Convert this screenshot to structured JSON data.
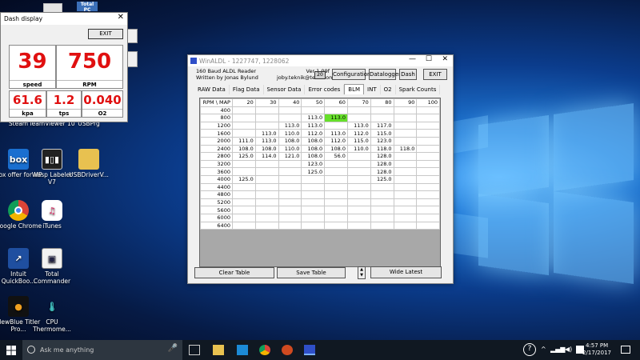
{
  "desktop_icons": [
    {
      "label": "Steam"
    },
    {
      "label": "TeamViewer 10"
    },
    {
      "label": "USBPrg"
    },
    {
      "label": "Box offer for HP",
      "badge": "box"
    },
    {
      "label": "Wasp Labeler V7"
    },
    {
      "label": "USBDriverV..."
    },
    {
      "label": "Google Chrome"
    },
    {
      "label": "iTunes"
    },
    {
      "label": "Intuit QuickBoo..."
    },
    {
      "label": "Total Commander"
    },
    {
      "label": "NewBlue Titler Pro..."
    },
    {
      "label": "CPU Thermome..."
    }
  ],
  "dash": {
    "title": "Dash display",
    "exit": "EXIT",
    "gauges": [
      {
        "value": "39",
        "label": "speed"
      },
      {
        "value": "750",
        "label": "RPM"
      },
      {
        "value": "61.6",
        "label": "kpa"
      },
      {
        "value": "1.2",
        "label": "tps"
      },
      {
        "value": "0.040",
        "label": "O2"
      }
    ]
  },
  "winaldl": {
    "title": "WinALDL - 1227747, 1228062",
    "line1": "160 Baud ALDL Reader",
    "line2": "Written by Jonas Bylund",
    "version": "Ver 1.09f",
    "email": "joby.teknik@telia.com",
    "counter": "20",
    "buttons": {
      "configuration": "Configuration",
      "datalogger": "Datalogger",
      "dash": "Dash",
      "exit": "EXIT"
    },
    "tabs": [
      "RAW Data",
      "Flag Data",
      "Sensor Data",
      "Error codes",
      "BLM",
      "INT",
      "O2",
      "Spark Counts"
    ],
    "active_tab": "BLM",
    "table": {
      "corner": "RPM \\ MAP",
      "cols": [
        "20",
        "30",
        "40",
        "50",
        "60",
        "70",
        "80",
        "90",
        "100"
      ],
      "rows": [
        {
          "rpm": "400",
          "cells": [
            "",
            "",
            "",
            "",
            "",
            "",
            "",
            "",
            ""
          ]
        },
        {
          "rpm": "800",
          "cells": [
            "",
            "",
            "",
            "113.0",
            "113.0",
            "",
            "",
            "",
            ""
          ]
        },
        {
          "rpm": "1200",
          "cells": [
            "",
            "",
            "113.0",
            "113.0",
            "",
            "113.0",
            "117.0",
            "",
            ""
          ]
        },
        {
          "rpm": "1600",
          "cells": [
            "",
            "113.0",
            "110.0",
            "112.0",
            "113.0",
            "112.0",
            "115.0",
            "",
            ""
          ]
        },
        {
          "rpm": "2000",
          "cells": [
            "111.0",
            "113.0",
            "108.0",
            "108.0",
            "112.0",
            "115.0",
            "123.0",
            "",
            ""
          ]
        },
        {
          "rpm": "2400",
          "cells": [
            "108.0",
            "108.0",
            "110.0",
            "108.0",
            "108.0",
            "110.0",
            "118.0",
            "118.0",
            ""
          ]
        },
        {
          "rpm": "2800",
          "cells": [
            "125.0",
            "114.0",
            "121.0",
            "108.0",
            "56.0",
            "",
            "128.0",
            "",
            ""
          ]
        },
        {
          "rpm": "3200",
          "cells": [
            "",
            "",
            "",
            "123.0",
            "",
            "",
            "128.0",
            "",
            ""
          ]
        },
        {
          "rpm": "3600",
          "cells": [
            "",
            "",
            "",
            "125.0",
            "",
            "",
            "128.0",
            "",
            ""
          ]
        },
        {
          "rpm": "4000",
          "cells": [
            "125.0",
            "",
            "",
            "",
            "",
            "",
            "125.0",
            "",
            ""
          ]
        },
        {
          "rpm": "4400",
          "cells": [
            "",
            "",
            "",
            "",
            "",
            "",
            "",
            "",
            ""
          ]
        },
        {
          "rpm": "4800",
          "cells": [
            "",
            "",
            "",
            "",
            "",
            "",
            "",
            "",
            ""
          ]
        },
        {
          "rpm": "5200",
          "cells": [
            "",
            "",
            "",
            "",
            "",
            "",
            "",
            "",
            ""
          ]
        },
        {
          "rpm": "5600",
          "cells": [
            "",
            "",
            "",
            "",
            "",
            "",
            "",
            "",
            ""
          ]
        },
        {
          "rpm": "6000",
          "cells": [
            "",
            "",
            "",
            "",
            "",
            "",
            "",
            "",
            ""
          ]
        },
        {
          "rpm": "6400",
          "cells": [
            "",
            "",
            "",
            "",
            "",
            "",
            "",
            "",
            ""
          ]
        }
      ],
      "highlight": {
        "row": 1,
        "col": 4
      }
    },
    "bottom_buttons": {
      "clear": "Clear Table",
      "save": "Save Table",
      "wide": "Wide Latest"
    }
  },
  "taskbar": {
    "search_placeholder": "Ask me anything",
    "time": "4:57 PM",
    "date": "2/17/2017"
  },
  "colors": {
    "gauge_value": "#e01010",
    "highlight_cell": "#66e02a"
  }
}
